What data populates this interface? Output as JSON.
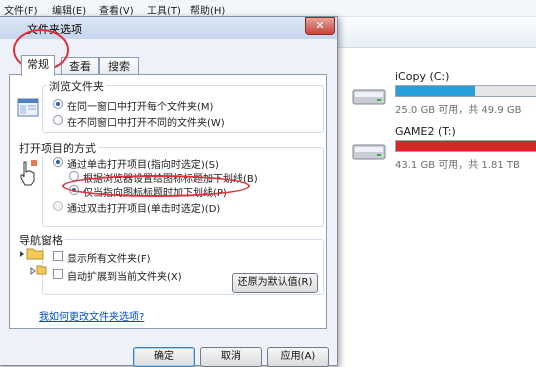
{
  "menubar": {
    "items": [
      "文件(F)",
      "编辑(E)",
      "查看(V)",
      "工具(T)",
      "帮助(H)"
    ]
  },
  "dialog": {
    "title": "文件夹选项",
    "close_label": "✕"
  },
  "tabs": [
    "常规",
    "查看",
    "搜索"
  ],
  "browse_folders": {
    "title": "浏览文件夹",
    "options": [
      "在同一窗口中打开每个文件夹(M)",
      "在不同窗口中打开不同的文件夹(W)"
    ],
    "selected": 0
  },
  "click_items": {
    "title": "打开项目的方式",
    "options": [
      "通过单击打开项目(指向时选定)(S)",
      "根据浏览器设置给图标标题加下划线(B)",
      "仅当指向图标标题时加下划线(P)",
      "通过双击打开项目(单击时选定)(D)"
    ],
    "selected_main": 0,
    "selected_sub": 2
  },
  "nav_pane": {
    "title": "导航窗格",
    "options": [
      "显示所有文件夹(F)",
      "自动扩展到当前文件夹(X)"
    ]
  },
  "restore_button": "还原为默认值(R)",
  "help_link": "我如何更改文件夹选项?",
  "footer_buttons": {
    "ok": "确定",
    "cancel": "取消",
    "apply": "应用(A)"
  },
  "drives": [
    {
      "name": "iCopy (C:)",
      "stat": "25.0 GB 可用，共 49.9 GB",
      "used_fraction": 0.5,
      "fill_color": "#26a0da"
    },
    {
      "name": "GAME2 (T:)",
      "stat": "43.1 GB 可用，共 1.81 TB",
      "used_fraction": 0.98,
      "fill_color": "#da2626"
    }
  ],
  "colors": {
    "accent": "#26a0da",
    "danger": "#da2626",
    "annotation": "#e0303a"
  }
}
